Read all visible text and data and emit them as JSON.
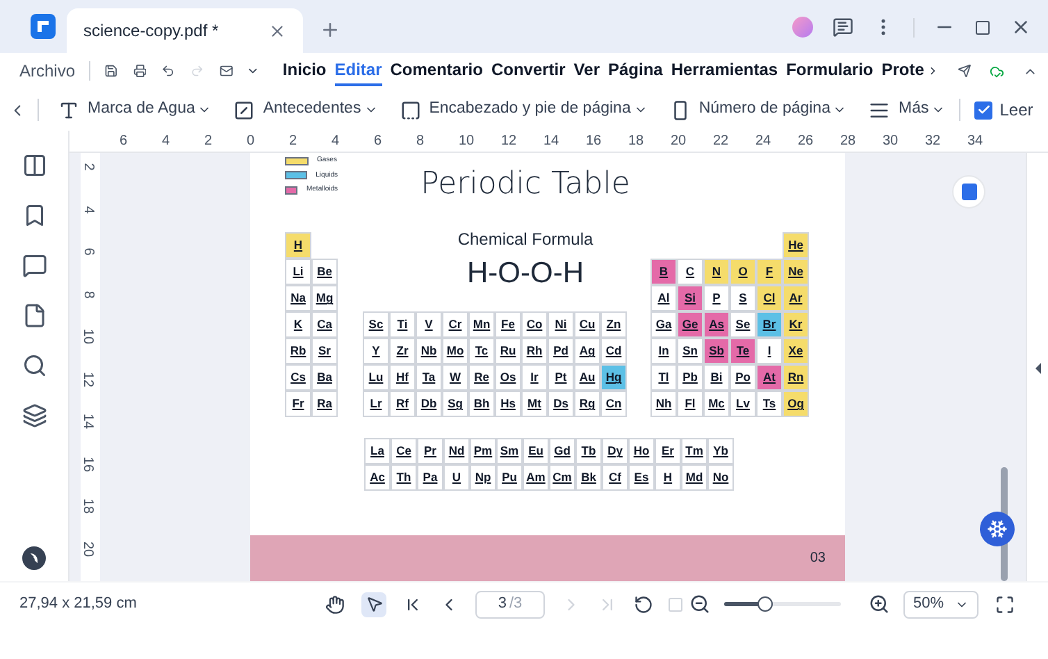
{
  "tab": {
    "title": "science-copy.pdf *"
  },
  "menu": {
    "file": "Archivo",
    "items": [
      {
        "label": "Inicio",
        "selected": false
      },
      {
        "label": "Editar",
        "selected": true
      },
      {
        "label": "Comentario",
        "selected": false
      },
      {
        "label": "Convertir",
        "selected": false
      },
      {
        "label": "Ver",
        "selected": false
      },
      {
        "label": "Página",
        "selected": false
      },
      {
        "label": "Herramientas",
        "selected": false
      },
      {
        "label": "Formulario",
        "selected": false
      },
      {
        "label": "Prote",
        "selected": false
      }
    ]
  },
  "toolbar": {
    "items": [
      {
        "kind": "watermark",
        "label": "Marca de Agua"
      },
      {
        "kind": "background",
        "label": "Antecedentes"
      },
      {
        "kind": "header",
        "label": "Encabezado y pie de página"
      },
      {
        "kind": "pagenum",
        "label": "Número de página"
      },
      {
        "kind": "more",
        "label": "Más"
      }
    ],
    "read": {
      "label": "Leer",
      "checked": true
    }
  },
  "ruler": {
    "horizontal": [
      "6",
      "4",
      "2",
      "0",
      "2",
      "4",
      "6",
      "8",
      "10",
      "12",
      "14",
      "16",
      "18",
      "20",
      "22",
      "24",
      "26",
      "28",
      "30",
      "32",
      "34"
    ],
    "vertical": [
      "2",
      "4",
      "6",
      "8",
      "10",
      "12",
      "14",
      "16",
      "18",
      "20"
    ]
  },
  "document": {
    "legend": [
      {
        "label": "Gases",
        "color": "#f5dc6b"
      },
      {
        "label": "Liquids",
        "color": "#5cc0e6"
      },
      {
        "label": "Metalloids",
        "color": "#e46aa8"
      }
    ],
    "title": "Periodic Table",
    "subtitle": "Chemical Formula",
    "formula": "H-O-O-H",
    "left_block": [
      [
        {
          "symbol": "H",
          "color": "#f5dc6b"
        }
      ],
      [
        {
          "symbol": "Li"
        },
        {
          "symbol": "Be"
        }
      ],
      [
        {
          "symbol": "Na"
        },
        {
          "symbol": "Mg"
        }
      ],
      [
        {
          "symbol": "K"
        },
        {
          "symbol": "Ca"
        }
      ],
      [
        {
          "symbol": "Rb"
        },
        {
          "symbol": "Sr"
        }
      ],
      [
        {
          "symbol": "Cs"
        },
        {
          "symbol": "Ba"
        }
      ],
      [
        {
          "symbol": "Fr"
        },
        {
          "symbol": "Ra"
        }
      ]
    ],
    "middle_block": [
      [
        {
          "symbol": "Sc"
        },
        {
          "symbol": "Ti"
        },
        {
          "symbol": "V"
        },
        {
          "symbol": "Cr"
        },
        {
          "symbol": "Mn"
        },
        {
          "symbol": "Fe"
        },
        {
          "symbol": "Co"
        },
        {
          "symbol": "Ni"
        },
        {
          "symbol": "Cu"
        },
        {
          "symbol": "Zn"
        }
      ],
      [
        {
          "symbol": "Y"
        },
        {
          "symbol": "Zr"
        },
        {
          "symbol": "Nb"
        },
        {
          "symbol": "Mo"
        },
        {
          "symbol": "Tc"
        },
        {
          "symbol": "Ru"
        },
        {
          "symbol": "Rh"
        },
        {
          "symbol": "Pd"
        },
        {
          "symbol": "Ag"
        },
        {
          "symbol": "Cd"
        }
      ],
      [
        {
          "symbol": "Lu"
        },
        {
          "symbol": "Hf"
        },
        {
          "symbol": "Ta"
        },
        {
          "symbol": "W"
        },
        {
          "symbol": "Re"
        },
        {
          "symbol": "Os"
        },
        {
          "symbol": "Ir"
        },
        {
          "symbol": "Pt"
        },
        {
          "symbol": "Au"
        },
        {
          "symbol": "Hg",
          "color": "#5cc0e6"
        }
      ],
      [
        {
          "symbol": "Lr"
        },
        {
          "symbol": "Rf"
        },
        {
          "symbol": "Db"
        },
        {
          "symbol": "Sg"
        },
        {
          "symbol": "Bh"
        },
        {
          "symbol": "Hs"
        },
        {
          "symbol": "Mt"
        },
        {
          "symbol": "Ds"
        },
        {
          "symbol": "Rg"
        },
        {
          "symbol": "Cn"
        }
      ]
    ],
    "right_block": [
      [
        {
          "symbol": "He",
          "color": "#f5dc6b"
        }
      ],
      [
        {
          "symbol": "B",
          "color": "#e46aa8"
        },
        {
          "symbol": "C"
        },
        {
          "symbol": "N",
          "color": "#f5dc6b"
        },
        {
          "symbol": "O",
          "color": "#f5dc6b"
        },
        {
          "symbol": "F",
          "color": "#f5dc6b"
        },
        {
          "symbol": "Ne",
          "color": "#f5dc6b"
        }
      ],
      [
        {
          "symbol": "Al"
        },
        {
          "symbol": "Si",
          "color": "#e46aa8"
        },
        {
          "symbol": "P"
        },
        {
          "symbol": "S"
        },
        {
          "symbol": "Cl",
          "color": "#f5dc6b"
        },
        {
          "symbol": "Ar",
          "color": "#f5dc6b"
        }
      ],
      [
        {
          "symbol": "Ga"
        },
        {
          "symbol": "Ge",
          "color": "#e46aa8"
        },
        {
          "symbol": "As",
          "color": "#e46aa8"
        },
        {
          "symbol": "Se"
        },
        {
          "symbol": "Br",
          "color": "#5cc0e6"
        },
        {
          "symbol": "Kr",
          "color": "#f5dc6b"
        }
      ],
      [
        {
          "symbol": "In"
        },
        {
          "symbol": "Sn"
        },
        {
          "symbol": "Sb",
          "color": "#e46aa8"
        },
        {
          "symbol": "Te",
          "color": "#e46aa8"
        },
        {
          "symbol": "I"
        },
        {
          "symbol": "Xe",
          "color": "#f5dc6b"
        }
      ],
      [
        {
          "symbol": "Tl"
        },
        {
          "symbol": "Pb"
        },
        {
          "symbol": "Bi"
        },
        {
          "symbol": "Po"
        },
        {
          "symbol": "At",
          "color": "#e46aa8"
        },
        {
          "symbol": "Rn",
          "color": "#f5dc6b"
        }
      ],
      [
        {
          "symbol": "Nh"
        },
        {
          "symbol": "Fl"
        },
        {
          "symbol": "Mc"
        },
        {
          "symbol": "Lv"
        },
        {
          "symbol": "Ts"
        },
        {
          "symbol": "Og",
          "color": "#f5dc6b"
        }
      ]
    ],
    "bottom_block": [
      [
        {
          "symbol": "La"
        },
        {
          "symbol": "Ce"
        },
        {
          "symbol": "Pr"
        },
        {
          "symbol": "Nd"
        },
        {
          "symbol": "Pm"
        },
        {
          "symbol": "Sm"
        },
        {
          "symbol": "Eu"
        },
        {
          "symbol": "Gd"
        },
        {
          "symbol": "Tb"
        },
        {
          "symbol": "Dy"
        },
        {
          "symbol": "Ho"
        },
        {
          "symbol": "Er"
        },
        {
          "symbol": "Tm"
        },
        {
          "symbol": "Yb"
        }
      ],
      [
        {
          "symbol": "Ac"
        },
        {
          "symbol": "Th"
        },
        {
          "symbol": "Pa"
        },
        {
          "symbol": "U"
        },
        {
          "symbol": "Np"
        },
        {
          "symbol": "Pu"
        },
        {
          "symbol": "Am"
        },
        {
          "symbol": "Cm"
        },
        {
          "symbol": "Bk"
        },
        {
          "symbol": "Cf"
        },
        {
          "symbol": "Es"
        },
        {
          "symbol": "H"
        },
        {
          "symbol": "Md"
        },
        {
          "symbol": "No"
        }
      ]
    ],
    "page_number": "03"
  },
  "status": {
    "size": "27,94 x 21,59 cm",
    "page": "3",
    "total": "/3",
    "zoom": "50%",
    "zoom_slider": {
      "level": 0.35
    }
  }
}
